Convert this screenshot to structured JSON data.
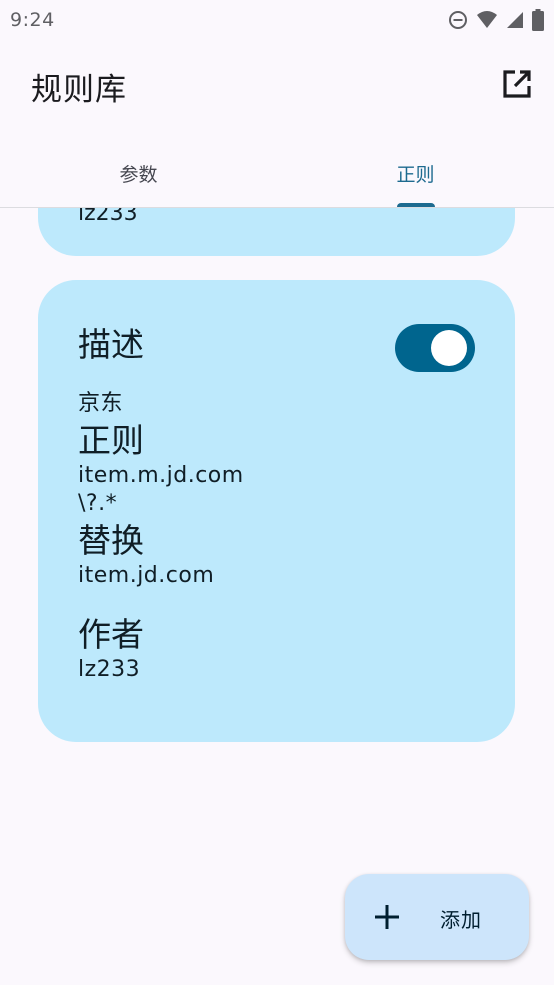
{
  "status_bar": {
    "time": "9:24",
    "icons": [
      "do-not-disturb-icon",
      "wifi-icon",
      "signal-icon",
      "battery-icon"
    ]
  },
  "app_bar": {
    "title": "规则库",
    "action_icon": "open-in-new-icon"
  },
  "tabs": [
    {
      "label": "参数",
      "active": false
    },
    {
      "label": "正则",
      "active": true
    }
  ],
  "previous_card": {
    "author_value": "lz233"
  },
  "rule_card": {
    "description_label": "描述",
    "description_value": "京东",
    "enabled": true,
    "regex_label": "正则",
    "regex_value_line1": "item.m.jd.com",
    "regex_value_line2": "\\?.*",
    "replace_label": "替换",
    "replace_value": "item.jd.com",
    "author_label": "作者",
    "author_value": "lz233"
  },
  "fab": {
    "icon": "plus-icon",
    "label": "添加"
  },
  "colors": {
    "background": "#fbf8fd",
    "card": "#bde9fc",
    "accent": "#1d6a8f",
    "toggle_track": "#00658e",
    "fab": "#cde5fb"
  }
}
